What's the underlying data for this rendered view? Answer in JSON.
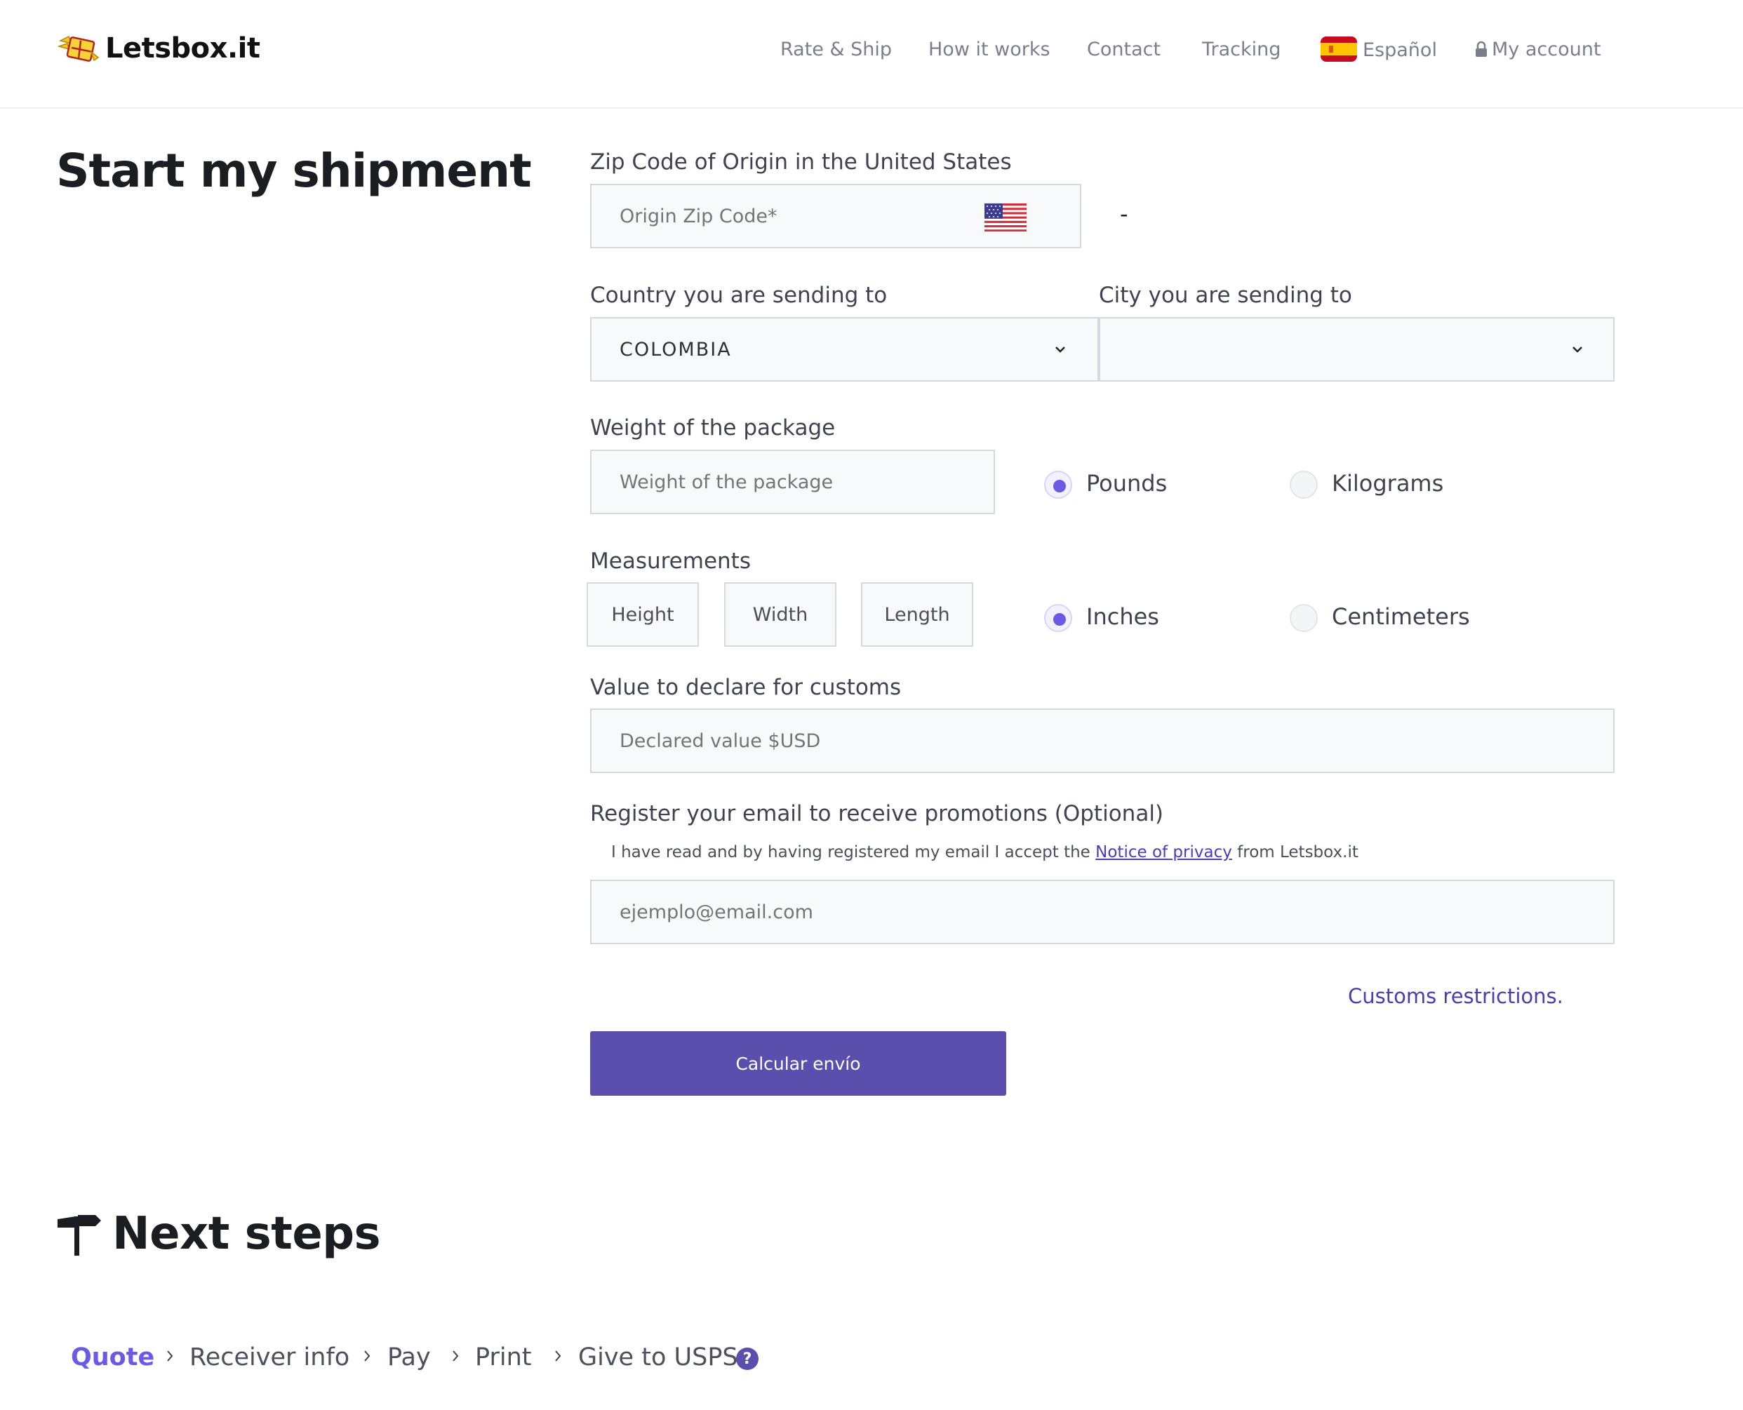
{
  "brand": {
    "name": "Letsbox.it",
    "logo_icon": "box-with-wings-logo"
  },
  "nav": {
    "items": [
      "Rate & Ship",
      "How it works",
      "Contact",
      "Tracking"
    ],
    "language": "Español",
    "account": "My account"
  },
  "page_title": "Start my shipment",
  "form": {
    "origin": {
      "label": "Zip Code of Origin in the United States",
      "placeholder": "Origin Zip Code*",
      "flag_icon": "us-flag-icon",
      "suffix": "-"
    },
    "country": {
      "label": "Country you are sending to",
      "value": "COLOMBIA"
    },
    "city": {
      "label": "City you are sending to",
      "value": ""
    },
    "weight": {
      "label": "Weight of the package",
      "placeholder": "Weight of the package",
      "units": [
        "Pounds",
        "Kilograms"
      ],
      "selected": "Pounds"
    },
    "measurements": {
      "label": "Measurements",
      "height": "Height",
      "width": "Width",
      "length": "Length",
      "units": [
        "Inches",
        "Centimeters"
      ],
      "selected": "Inches"
    },
    "value": {
      "label": "Value to declare for customs",
      "placeholder": "Declared value $USD"
    },
    "email": {
      "label": "Register your email to receive promotions (Optional)",
      "privacy_pre": "I have read and by having registered my email I accept the",
      "privacy_link": "Notice of privacy",
      "privacy_post": "from Letsbox.it",
      "placeholder": "ejemplo@email.com"
    },
    "customs_link": "Customs restrictions.",
    "submit": "Calcular envío"
  },
  "next_steps": {
    "title": "Next steps",
    "steps": [
      "Quote",
      "Receiver info",
      "Pay",
      "Print",
      "Give to USPS"
    ],
    "active": "Quote"
  },
  "colors": {
    "accent": "#6a5be2",
    "button": "#5b4fae",
    "link": "#4a3fa8"
  }
}
